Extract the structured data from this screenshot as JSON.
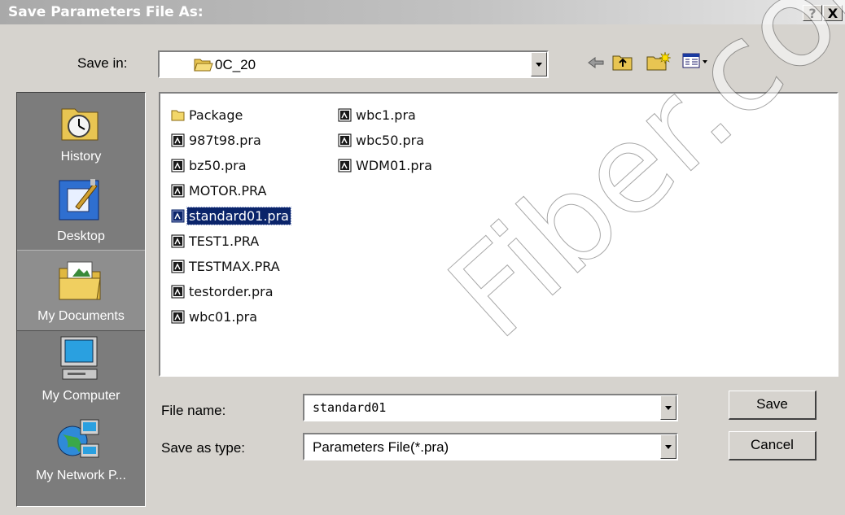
{
  "window": {
    "title": "Save Parameters File As:",
    "help_label": "?",
    "close_label": "X"
  },
  "save_in": {
    "label": "Save in:",
    "folder": "0C_20"
  },
  "places": [
    {
      "label": "History",
      "icon": "history-icon"
    },
    {
      "label": "Desktop",
      "icon": "desktop-icon"
    },
    {
      "label": "My Documents",
      "icon": "my-documents-icon"
    },
    {
      "label": "My Computer",
      "icon": "my-computer-icon"
    },
    {
      "label": "My Network P...",
      "icon": "my-network-places-icon"
    }
  ],
  "files": [
    {
      "name": "Package",
      "type": "folder"
    },
    {
      "name": "987t98.pra",
      "type": "file"
    },
    {
      "name": "bz50.pra",
      "type": "file"
    },
    {
      "name": "MOTOR.PRA",
      "type": "file"
    },
    {
      "name": "standard01.pra",
      "type": "file",
      "selected": true
    },
    {
      "name": "TEST1.PRA",
      "type": "file"
    },
    {
      "name": "TESTMAX.PRA",
      "type": "file"
    },
    {
      "name": "testorder.pra",
      "type": "file"
    },
    {
      "name": "wbc01.pra",
      "type": "file"
    },
    {
      "name": "wbc1.pra",
      "type": "file"
    },
    {
      "name": "wbc50.pra",
      "type": "file"
    },
    {
      "name": "WDM01.pra",
      "type": "file"
    }
  ],
  "filename": {
    "label": "File name:",
    "value": "standard01"
  },
  "filetype": {
    "label": "Save as type:",
    "value": "Parameters File(*.pra)"
  },
  "buttons": {
    "save": "Save",
    "cancel": "Cancel"
  },
  "watermark": "Fiber.com",
  "colors": {
    "selection": "#0a246a",
    "dialog_face": "#d6d3ce",
    "places_bar": "#7c7c7c"
  }
}
